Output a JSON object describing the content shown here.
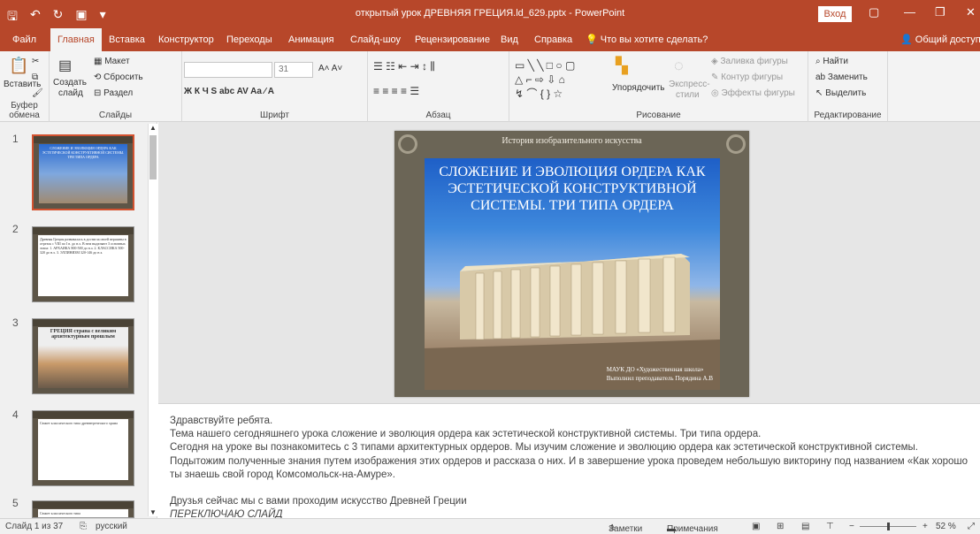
{
  "window": {
    "title": "открытый урок ДРЕВНЯЯ ГРЕЦИЯ.ld_629.pptx  -  PowerPoint",
    "login": "Вход"
  },
  "tabs": [
    {
      "label": "Файл"
    },
    {
      "label": "Главная"
    },
    {
      "label": "Вставка"
    },
    {
      "label": "Конструктор"
    },
    {
      "label": "Переходы"
    },
    {
      "label": "Анимация"
    },
    {
      "label": "Слайд-шоу"
    },
    {
      "label": "Рецензирование"
    },
    {
      "label": "Вид"
    },
    {
      "label": "Справка"
    }
  ],
  "tellme": "Что вы хотите сделать?",
  "share": "Общий доступ",
  "ribbon": {
    "clipboard": {
      "paste": "Вставить",
      "label": "Буфер обмена"
    },
    "slides": {
      "new": "Создать",
      "new2": "слайд",
      "layout": "Макет",
      "reset": "Сбросить",
      "section": "Раздел",
      "label": "Слайды"
    },
    "font": {
      "size": "31",
      "label": "Шрифт"
    },
    "paragraph": {
      "label": "Абзац"
    },
    "drawing": {
      "arrange": "Упорядочить",
      "styles": "Экспресс-",
      "styles2": "стили",
      "fill": "Заливка фигуры",
      "outline": "Контур фигуры",
      "effects": "Эффекты фигуры",
      "label": "Рисование"
    },
    "editing": {
      "find": "Найти",
      "replace": "Заменить",
      "select": "Выделить",
      "label": "Редактирование"
    }
  },
  "thumbnails": [
    {
      "num": "1",
      "text": "СЛОЖЕНИЕ И ЭВОЛЮЦИЯ ОРДЕРА КАК ЭСТЕТИЧЕСКОЙ КОНСТРУКТИВНОЙ СИСТЕМЫ. ТРИ ТИПА ОРДЕРА"
    },
    {
      "num": "2",
      "text": "Древняя Греция развивалась в достигла своей вершины в отрезок с VIII по I в. до н.э. В нем выделяют 3 основных этапа: 1. АРХАИКА 800-500 до н.э. 2. КЛАССИКА 500-320 до н.э. 3. ЭЛЛИНИЗМ 320-146 до н.э."
    },
    {
      "num": "3",
      "text": "ГРЕЦИЯ страна с великим архитектурным прошлым"
    },
    {
      "num": "4",
      "text": "Сюжет классического типа древнегреческого храма"
    },
    {
      "num": "5",
      "text": "Сюжет классического типа"
    }
  ],
  "slide": {
    "caption": "История изобразительного искусства",
    "title": "СЛОЖЕНИЕ И ЭВОЛЮЦИЯ ОРДЕРА КАК ЭСТЕТИЧЕСКОЙ КОНСТРУКТИВНОЙ СИСТЕМЫ. ТРИ ТИПА ОРДЕРА",
    "author1": "МАУК ДО «Художественная школа»",
    "author2": "Выполнил преподаватель Порядина А.В"
  },
  "notes": [
    "Здравствуйте ребята.",
    "Тема нашего сегодняшнего урока сложение и эволюция ордера как эстетической конструктивной системы. Три типа ордера.",
    "Сегодня на уроке вы познакомитесь с 3 типами архитектурных ордеров. Мы изучим сложение и эволюцию ордера как эстетической конструктивной системы. Подытожим полученные  знания путем изображения этих ордеров и рассказа о них. И в завершение урока проведем небольшую викторину под названием «Как хорошо ты знаешь свой город Комсомольск-на-Амуре».",
    "",
    "Друзья сейчас мы с вами проходим искусство Древней Греции",
    "ПЕРЕКЛЮЧАЮ СЛАЙД"
  ],
  "status": {
    "slide": "Слайд 1 из 37",
    "lang": "русский",
    "notes": "Заметки",
    "comments": "Примечания",
    "zoom": "52 %"
  }
}
